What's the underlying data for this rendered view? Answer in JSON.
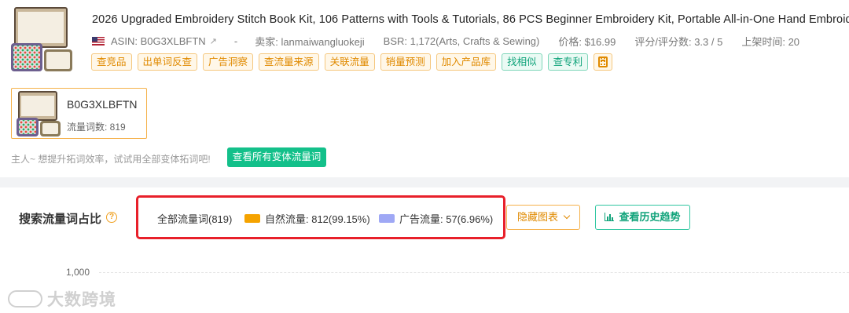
{
  "product": {
    "title": "2026 Upgraded Embroidery Stitch Book Kit, 106 Patterns with Tools & Tutorials, 86 PCS Beginner Embroidery Kit, Portable All-in-One Hand Embroid",
    "asin_label": "ASIN: B0G3XLBFTN",
    "separator": "-",
    "seller_label": "卖家: lanmaiwangluokeji",
    "bsr_label": "BSR: 1,172(Arts, Crafts & Sewing)",
    "price_label": "价格: $16.99",
    "rating_label": "评分/评分数: 3.3 / 5",
    "listed_label": "上架时间: 20",
    "icon_flag": "us-flag-icon",
    "icon_external": "external-link-icon"
  },
  "tags": [
    {
      "label": "查竞品",
      "style": "orange"
    },
    {
      "label": "出单词反查",
      "style": "orange"
    },
    {
      "label": "广告洞察",
      "style": "orange"
    },
    {
      "label": "查流量来源",
      "style": "orange"
    },
    {
      "label": "关联流量",
      "style": "orange"
    },
    {
      "label": "销量预测",
      "style": "orange"
    },
    {
      "label": "加入产品库",
      "style": "orange"
    },
    {
      "label": "找相似",
      "style": "green"
    },
    {
      "label": "查专利",
      "style": "green"
    }
  ],
  "variant_card": {
    "asin": "B0G3XLBFTN",
    "traffic_words": "流量词数: 819"
  },
  "hint": {
    "text": "主人~ 想提升拓词效率，试试用全部变体拓词吧!",
    "button": "查看所有变体流量词"
  },
  "traffic_section": {
    "title": "搜索流量词占比",
    "help_icon": "?",
    "all_words": "全部流量词(819)",
    "natural": "自然流量: 812(99.15%)",
    "ads": "广告流量: 57(6.96%)",
    "natural_color": "#f5a300",
    "ads_color": "#9fa8f5",
    "hide_chart_button": "隐藏图表",
    "history_button": "查看历史趋势",
    "highlight_color": "#e8202a"
  },
  "chart": {
    "y_tick_top": "1,000"
  },
  "watermark": {
    "text": "大数跨境"
  }
}
